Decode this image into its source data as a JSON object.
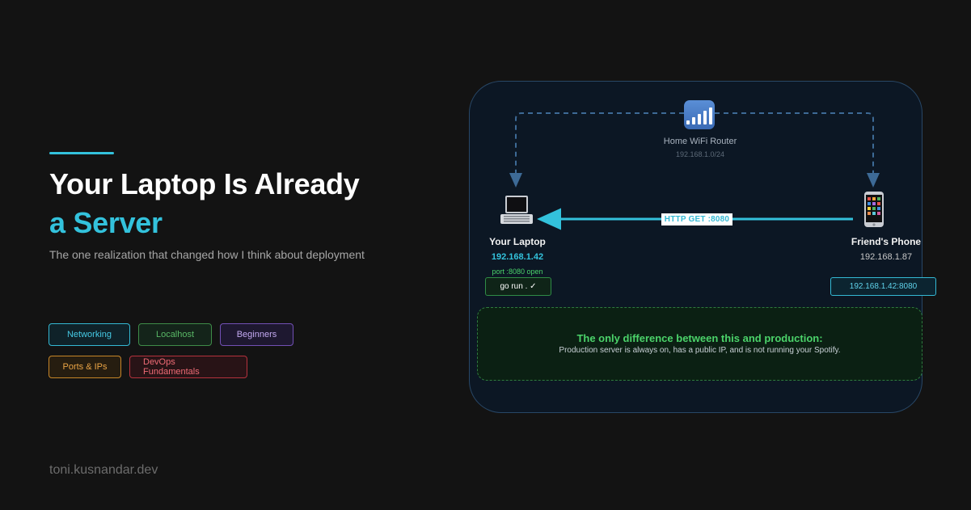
{
  "header": {
    "title_line1": "Your Laptop Is Already",
    "title_line2": "a Server",
    "subtitle": "The one realization that changed how I think about deployment"
  },
  "tags": [
    {
      "label": "Networking",
      "color": "#34b9d4"
    },
    {
      "label": "Localhost",
      "color": "#3e8c48"
    },
    {
      "label": "Beginners",
      "color": "#7250b5"
    },
    {
      "label": "Ports & IPs",
      "color": "#c78628"
    },
    {
      "label": "DevOps Fundamentals",
      "color": "#b5323d"
    }
  ],
  "footer": {
    "site": "toni.kusnandar.dev"
  },
  "diagram": {
    "router": {
      "icon": "signal-bars-icon",
      "name": "Home WiFi Router",
      "subnet": "192.168.1.0/24"
    },
    "laptop": {
      "icon": "laptop-icon",
      "name": "Your Laptop",
      "ip": "192.168.1.42",
      "port_status": "port :8080 open",
      "command": "go run . ✓"
    },
    "phone": {
      "icon": "mobile-phone-icon",
      "name": "Friend's Phone",
      "ip": "192.168.1.87",
      "target": "192.168.1.42:8080"
    },
    "request": {
      "label": "HTTP GET :8080"
    },
    "note": {
      "title": "The only difference between this and production:",
      "body": "Production server is always on, has a public IP, and is not running your Spotify."
    },
    "colors": {
      "accent": "#33c2dc",
      "success": "#4bd36a",
      "panel_border": "#284766",
      "dashed_link": "#3d6a96"
    }
  }
}
